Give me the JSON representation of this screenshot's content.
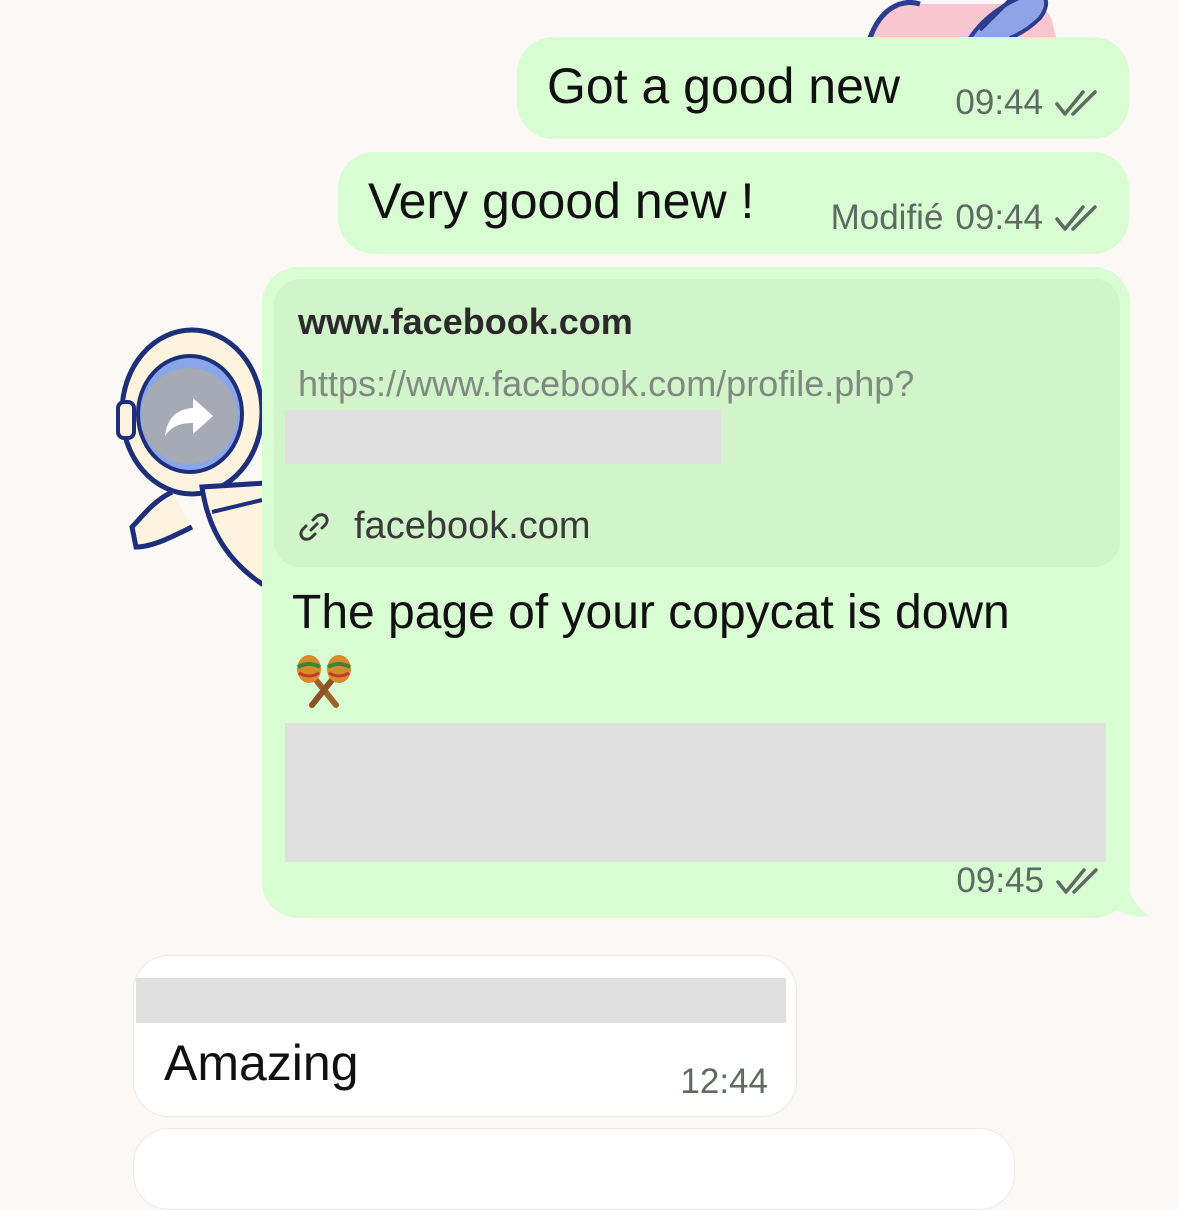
{
  "messages": [
    {
      "direction": "out",
      "text": "Got a good new",
      "edited_label": "",
      "time": "09:44",
      "status": "read"
    },
    {
      "direction": "out",
      "text": "Very goood new !",
      "edited_label": "Modifié",
      "time": "09:44",
      "status": "read"
    },
    {
      "direction": "out",
      "link_preview": {
        "title": "www.facebook.com",
        "url": "https://www.facebook.com/profile.php?",
        "domain": "facebook.com",
        "icon": "link-icon"
      },
      "text": "The page of your copycat is down",
      "emoji": "maracas",
      "time": "09:45",
      "status": "read"
    },
    {
      "direction": "in",
      "text": "Amazing",
      "time": "12:44"
    }
  ],
  "overlay": {
    "forward_icon": "forward-arrow-icon"
  },
  "colors": {
    "outgoing_bubble": "#d9fdd3",
    "link_card": "#d2f4cb",
    "incoming_bubble": "#ffffff",
    "background": "#fcf8f5",
    "meta_text": "#5e6a62",
    "redaction": "#e0e0e0"
  }
}
